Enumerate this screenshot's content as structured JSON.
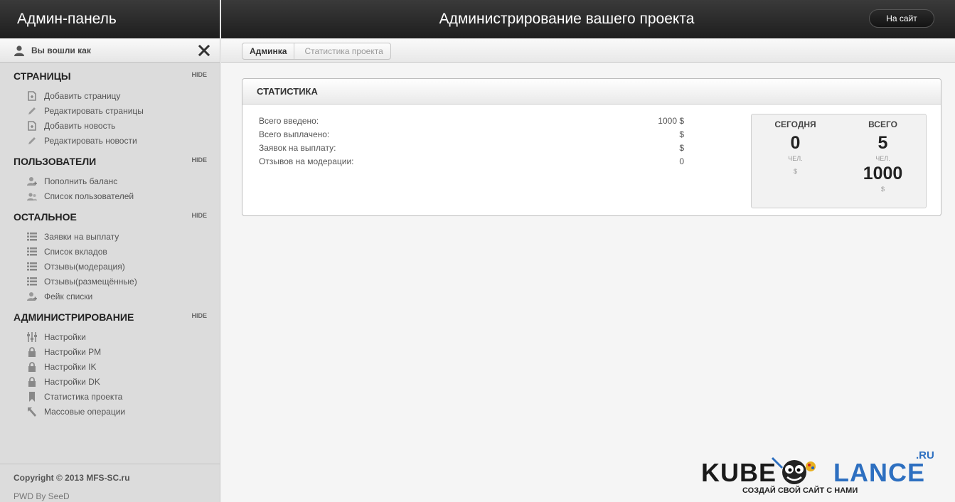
{
  "sidebar": {
    "brand": "Админ-панель",
    "user_label": "Вы вошли как",
    "sections": [
      {
        "title": "СТРАНИЦЫ",
        "hide": "HIDE",
        "items": [
          {
            "label": "Добавить страницу",
            "icon": "add-page-icon"
          },
          {
            "label": "Редактировать страницы",
            "icon": "pencil-icon"
          },
          {
            "label": "Добавить новость",
            "icon": "add-page-icon"
          },
          {
            "label": "Редактировать новости",
            "icon": "pencil-icon"
          }
        ]
      },
      {
        "title": "ПОЛЬЗОВАТЕЛИ",
        "hide": "HIDE",
        "items": [
          {
            "label": "Пополнить баланс",
            "icon": "user-add-icon"
          },
          {
            "label": "Список пользователей",
            "icon": "users-icon"
          }
        ]
      },
      {
        "title": "ОСТАЛЬНОЕ",
        "hide": "HIDE",
        "items": [
          {
            "label": "Заявки на выплату",
            "icon": "list-icon"
          },
          {
            "label": "Список вкладов",
            "icon": "list-icon"
          },
          {
            "label": "Отзывы(модерация)",
            "icon": "list-icon"
          },
          {
            "label": "Отзывы(размещённые)",
            "icon": "list-icon"
          },
          {
            "label": "Фейк списки",
            "icon": "user-add-icon"
          }
        ]
      },
      {
        "title": "АДМИНИСТРИРОВАНИЕ",
        "hide": "HIDE",
        "items": [
          {
            "label": "Настройки",
            "icon": "sliders-icon"
          },
          {
            "label": "Настройки PM",
            "icon": "lock-icon"
          },
          {
            "label": "Настройки IK",
            "icon": "lock-icon"
          },
          {
            "label": "Настройки DK",
            "icon": "lock-icon"
          },
          {
            "label": "Статистика проекта",
            "icon": "bookmark-icon"
          },
          {
            "label": "Массовые операции",
            "icon": "arrow-back-icon"
          }
        ]
      }
    ],
    "footer": {
      "copyright": "Copyright © 2013 MFS-SC.ru",
      "pwd": "PWD By SeeD"
    }
  },
  "header": {
    "title": "Администрирование вашего проекта",
    "site_button": "На сайт"
  },
  "breadcrumb": {
    "home": "Админка",
    "current": "Статистика проекта"
  },
  "stats": {
    "title": "СТАТИСТИКА",
    "rows": [
      {
        "label": "Всего введено:",
        "value": "1000 $"
      },
      {
        "label": "Всего выплачено:",
        "value": "$"
      },
      {
        "label": "Заявок на выплату:",
        "value": "$"
      },
      {
        "label": "Отзывов на модерации:",
        "value": "0"
      }
    ],
    "summary": {
      "today": {
        "heading": "СЕГОДНЯ",
        "count": "0",
        "count_unit": "ЧЕЛ.",
        "money_unit": "$"
      },
      "total": {
        "heading": "ВСЕГО",
        "count": "5",
        "count_unit": "ЧЕЛ.",
        "money": "1000",
        "money_unit": "$"
      }
    }
  },
  "watermark": {
    "part1": "KUBE",
    "part2": "LANCE",
    "suffix": ".RU",
    "slogan": "СОЗДАЙ СВОЙ САЙТ С НАМИ"
  }
}
